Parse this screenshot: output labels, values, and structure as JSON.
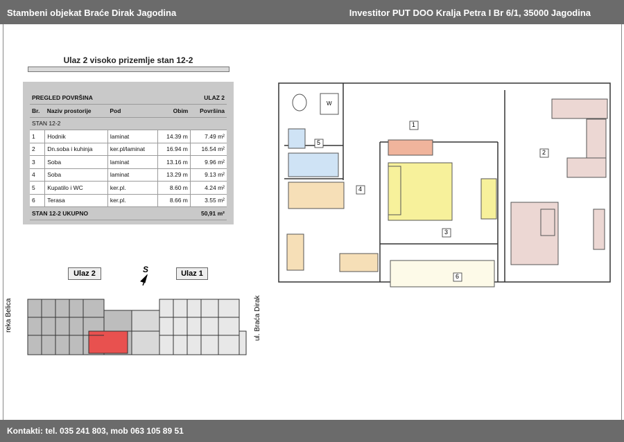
{
  "header": {
    "left": "Stambeni objekat Braće Dirak  Jagodina",
    "right": "Investitor PUT DOO Kralja Petra I Br 6/1, 35000 Jagodina"
  },
  "subtitle": "Ulaz 2 visoko prizemlje stan 12-2",
  "table": {
    "title": "PREGLED POVRŠINA",
    "entrance": "ULAZ 2",
    "columns": [
      "Br.",
      "Naziv prostorije",
      "Pod",
      "Obim",
      "Površina"
    ],
    "section": "STAN 12-2",
    "rows": [
      [
        "1",
        "Hodnik",
        "laminat",
        "14.39 m",
        "7.49 m²"
      ],
      [
        "2",
        "Dn.soba i kuhinja",
        "ker.pl/laminat",
        "16.94 m",
        "16.54 m²"
      ],
      [
        "3",
        "Soba",
        "laminat",
        "13.16 m",
        "9.96 m²"
      ],
      [
        "4",
        "Soba",
        "laminat",
        "13.29 m",
        "9.13 m²"
      ],
      [
        "5",
        "Kupatilo i WC",
        "ker.pl.",
        "8.60 m",
        "4.24 m²"
      ],
      [
        "6",
        "Terasa",
        "ker.pl.",
        "8.66 m",
        "3.55 m²"
      ]
    ],
    "total_label": "STAN 12-2  UKUPNO",
    "total_value": "50,91 m²"
  },
  "site": {
    "ulaz2": "Ulaz 2",
    "ulaz1": "Ulaz 1",
    "north": "S",
    "left_street": "reka Belica",
    "right_street": "ul. Braća Dirak"
  },
  "plan": {
    "room_numbers": [
      "1",
      "2",
      "3",
      "4",
      "5",
      "6"
    ],
    "wc_label": "W"
  },
  "footer": "Kontakti: tel. 035 241 803, mob 063 105 89 51"
}
